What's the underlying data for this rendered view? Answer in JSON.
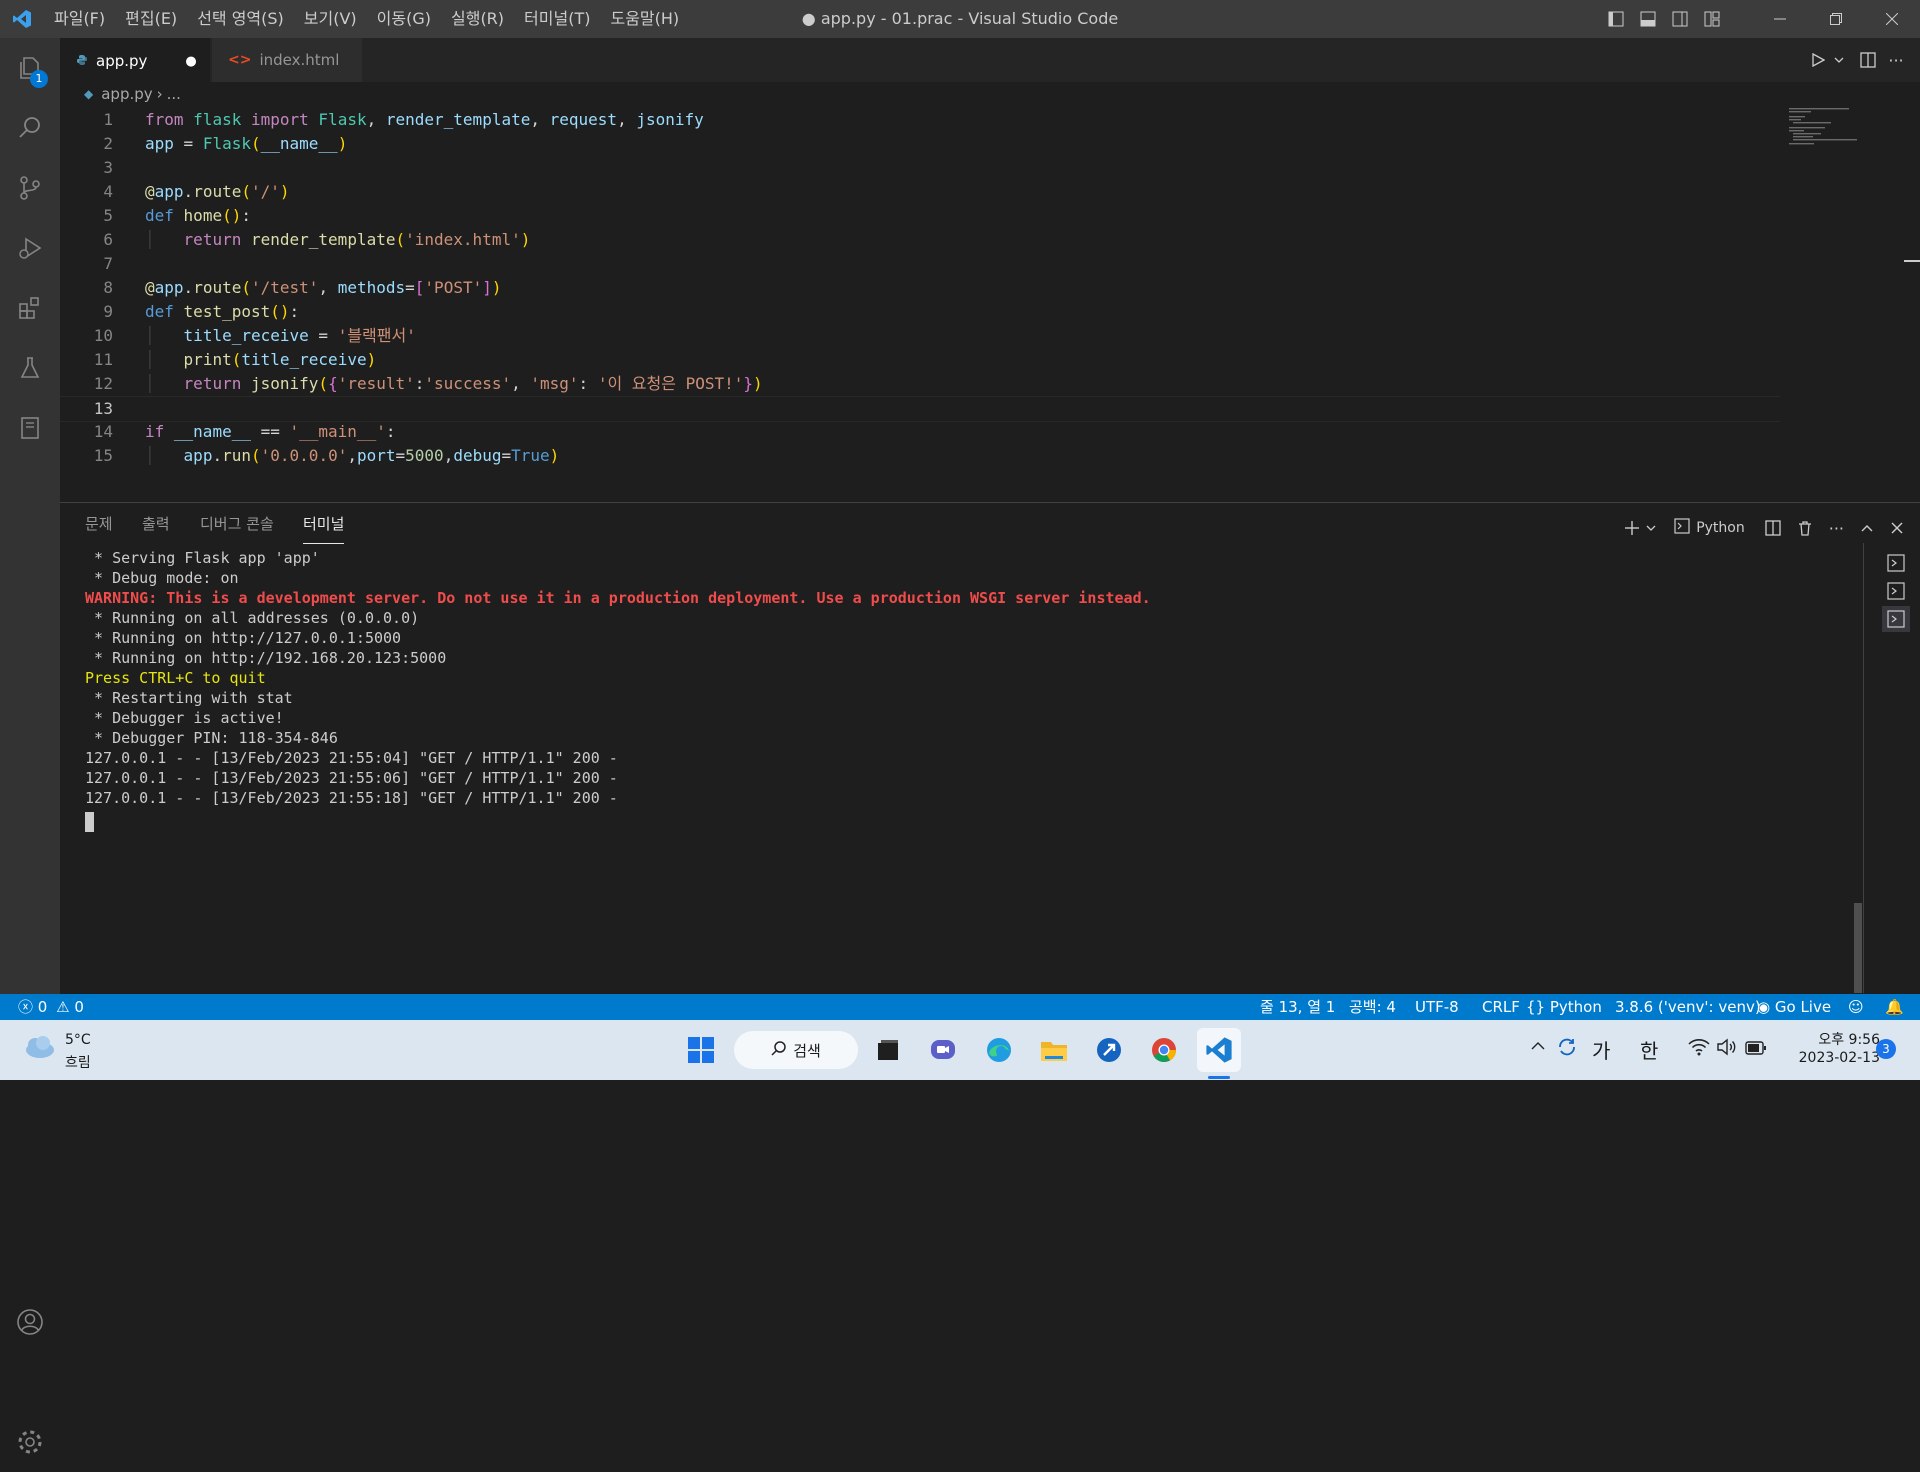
{
  "titlebar": {
    "menus": [
      "파일(F)",
      "편집(E)",
      "선택 영역(S)",
      "보기(V)",
      "이동(G)",
      "실행(R)",
      "터미널(T)",
      "도움말(H)"
    ],
    "title": "● app.py - 01.prac - Visual Studio Code"
  },
  "activitybar": {
    "explorer_badge": "1"
  },
  "tabs": [
    {
      "label": "app.py",
      "modified_marker": "●"
    },
    {
      "label": "index.html"
    }
  ],
  "breadcrumb": {
    "file": "app.py",
    "rest": "..."
  },
  "editor": {
    "line_numbers": [
      "1",
      "2",
      "3",
      "4",
      "5",
      "6",
      "7",
      "8",
      "9",
      "10",
      "11",
      "12",
      "13",
      "14",
      "15"
    ],
    "lines": [
      "from flask import Flask, render_template, request, jsonify",
      "app = Flask(__name__)",
      "",
      "@app.route('/')",
      "def home():",
      "    return render_template('index.html')",
      "",
      "@app.route('/test', methods=['POST'])",
      "def test_post():",
      "    title_receive = '블랙팬서'",
      "    print(title_receive)",
      "    return jsonify({'result':'success', 'msg': '이 요청은 POST!'})",
      "",
      "if __name__ == '__main__':",
      "    app.run('0.0.0.0',port=5000,debug=True)"
    ],
    "current_line": 13
  },
  "panel": {
    "tabs": [
      "문제",
      "출력",
      "디버그 콘솔",
      "터미널"
    ],
    "active_tab": "터미널",
    "terminal_profile": "Python",
    "terminal_lines": [
      " * Serving Flask app 'app'",
      " * Debug mode: on",
      "WARNING: This is a development server. Do not use it in a production deployment. Use a production WSGI server instead.",
      " * Running on all addresses (0.0.0.0)",
      " * Running on http://127.0.0.1:5000",
      " * Running on http://192.168.20.123:5000",
      "Press CTRL+C to quit",
      " * Restarting with stat",
      " * Debugger is active!",
      " * Debugger PIN: 118-354-846",
      "127.0.0.1 - - [13/Feb/2023 21:55:04] \"GET / HTTP/1.1\" 200 -",
      "127.0.0.1 - - [13/Feb/2023 21:55:06] \"GET / HTTP/1.1\" 200 -",
      "127.0.0.1 - - [13/Feb/2023 21:55:18] \"GET / HTTP/1.1\" 200 -"
    ]
  },
  "statusbar": {
    "errors": "0",
    "warnings": "0",
    "position": "줄 13, 열 1",
    "spaces": "공백: 4",
    "encoding": "UTF-8",
    "eol": "CRLF",
    "language": "Python",
    "interpreter": "3.8.6 ('venv': venv)",
    "go_live": "Go Live"
  },
  "taskbar": {
    "weather_temp": "5°C",
    "weather_desc": "흐림",
    "search_label": "검색",
    "ime_mode": "가",
    "ime_lang": "한",
    "time": "오후 9:56",
    "date": "2023-02-13",
    "notification_count": "3"
  },
  "colors": {
    "accent": "#007acc",
    "titlebar": "#3c3c3c",
    "activitybar": "#333333",
    "editor_bg": "#1e1e1e",
    "warning": "#f14c4c"
  }
}
